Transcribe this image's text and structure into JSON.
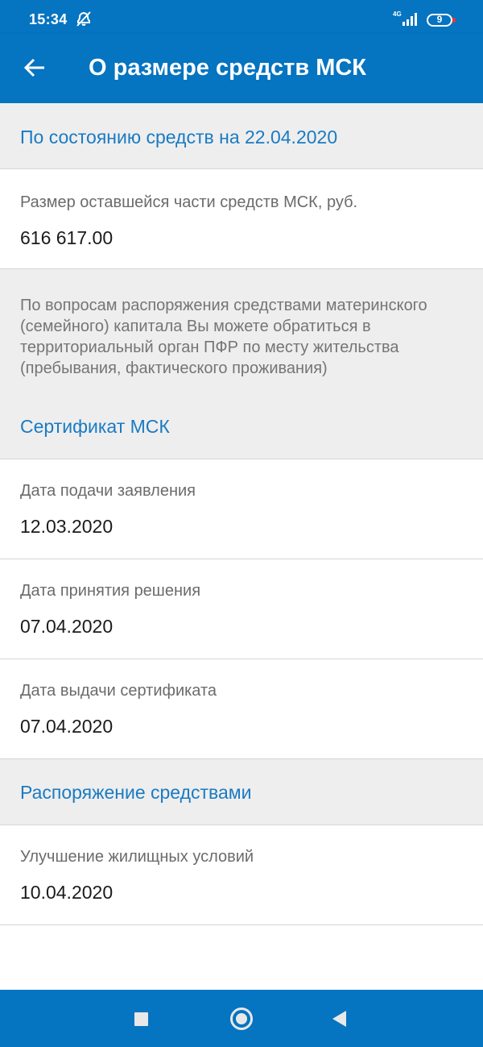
{
  "status_bar": {
    "time": "15:34",
    "network": "4G",
    "battery": "9"
  },
  "app_bar": {
    "title": "О размере средств МСК"
  },
  "balance_header": "По состоянию средств на 22.04.2020",
  "remaining": {
    "label": "Размер оставшейся части средств МСК, руб.",
    "value": "616 617.00"
  },
  "info": {
    "text": "По вопросам распоряжения средствами материнского (семейного) капитала Вы можете обратиться в территориальный орган ПФР по месту жительства (пребывания, фактического проживания)",
    "certificate_link": "Сертификат МСК"
  },
  "certificate_fields": [
    {
      "label": "Дата подачи заявления",
      "value": "12.03.2020"
    },
    {
      "label": "Дата принятия решения",
      "value": "07.04.2020"
    },
    {
      "label": "Дата выдачи сертификата",
      "value": "07.04.2020"
    }
  ],
  "disposal": {
    "header": "Распоряжение средствами",
    "items": [
      {
        "label": "Улучшение жилищных условий",
        "value": "10.04.2020"
      }
    ]
  },
  "colors": {
    "primary": "#0574c1",
    "link": "#1a7bc2",
    "section_gray": "#eeeeee"
  },
  "icons": [
    "alarm-off-icon",
    "signal-icon",
    "battery-icon",
    "back-arrow-icon",
    "recents-icon",
    "home-icon",
    "nav-back-icon"
  ]
}
